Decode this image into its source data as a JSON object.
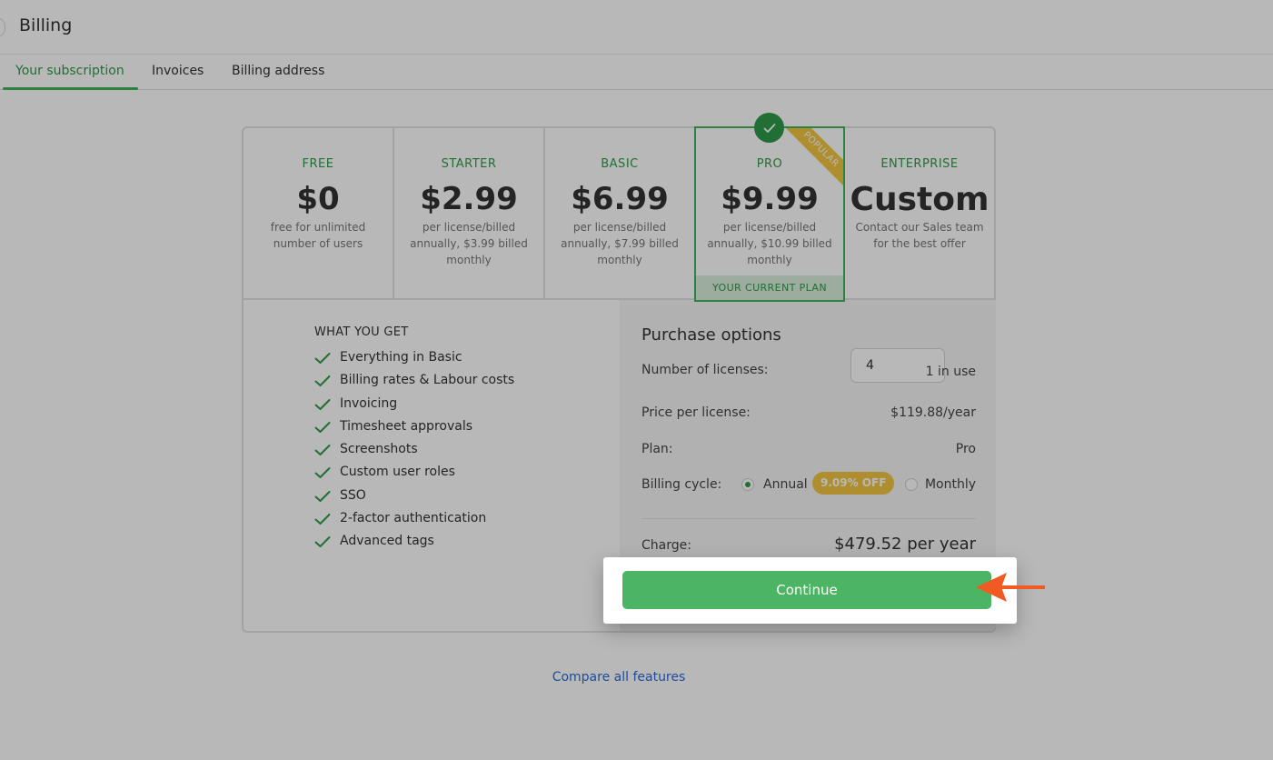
{
  "header": {
    "title": "Billing"
  },
  "tabs": [
    {
      "label": "Your subscription",
      "active": true
    },
    {
      "label": "Invoices",
      "active": false
    },
    {
      "label": "Billing address",
      "active": false
    }
  ],
  "plans": [
    {
      "name": "FREE",
      "price": "$0",
      "description": "free for unlimited number of users"
    },
    {
      "name": "STARTER",
      "price": "$2.99",
      "description": "per license/billed annually, $3.99 billed monthly"
    },
    {
      "name": "BASIC",
      "price": "$6.99",
      "description": "per license/billed annually, $7.99 billed monthly"
    },
    {
      "name": "PRO",
      "price": "$9.99",
      "description": "per license/billed annually, $10.99 billed monthly",
      "ribbon": "POPULAR",
      "current_label": "YOUR CURRENT PLAN"
    },
    {
      "name": "ENTERPRISE",
      "price": "Custom",
      "description": "Contact our Sales team for the best offer"
    }
  ],
  "features": {
    "heading": "WHAT YOU GET",
    "items": [
      "Everything in Basic",
      "Billing rates & Labour costs",
      "Invoicing",
      "Timesheet approvals",
      "Screenshots",
      "Custom user roles",
      "SSO",
      "2-factor authentication",
      "Advanced tags"
    ]
  },
  "purchase": {
    "title": "Purchase options",
    "licenses_label": "Number of licenses:",
    "licenses_value": "4",
    "in_use": "1 in use",
    "price_label": "Price per license:",
    "price_value": "$119.88/year",
    "plan_label": "Plan:",
    "plan_value": "Pro",
    "billing_label": "Billing cycle:",
    "annual_label": "Annual",
    "discount_badge": "9.09% OFF",
    "monthly_label": "Monthly",
    "selected_cycle": "Annual",
    "charge_label": "Charge:",
    "charge_value": "$479.52 per year",
    "continue_label": "Continue"
  },
  "compare_link": "Compare all features",
  "colors": {
    "accent": "#3fb35b",
    "brand_green": "#2f9a48",
    "badge_yellow": "#f3c542",
    "arrow": "#f25a24",
    "link": "#2b6bd6"
  }
}
